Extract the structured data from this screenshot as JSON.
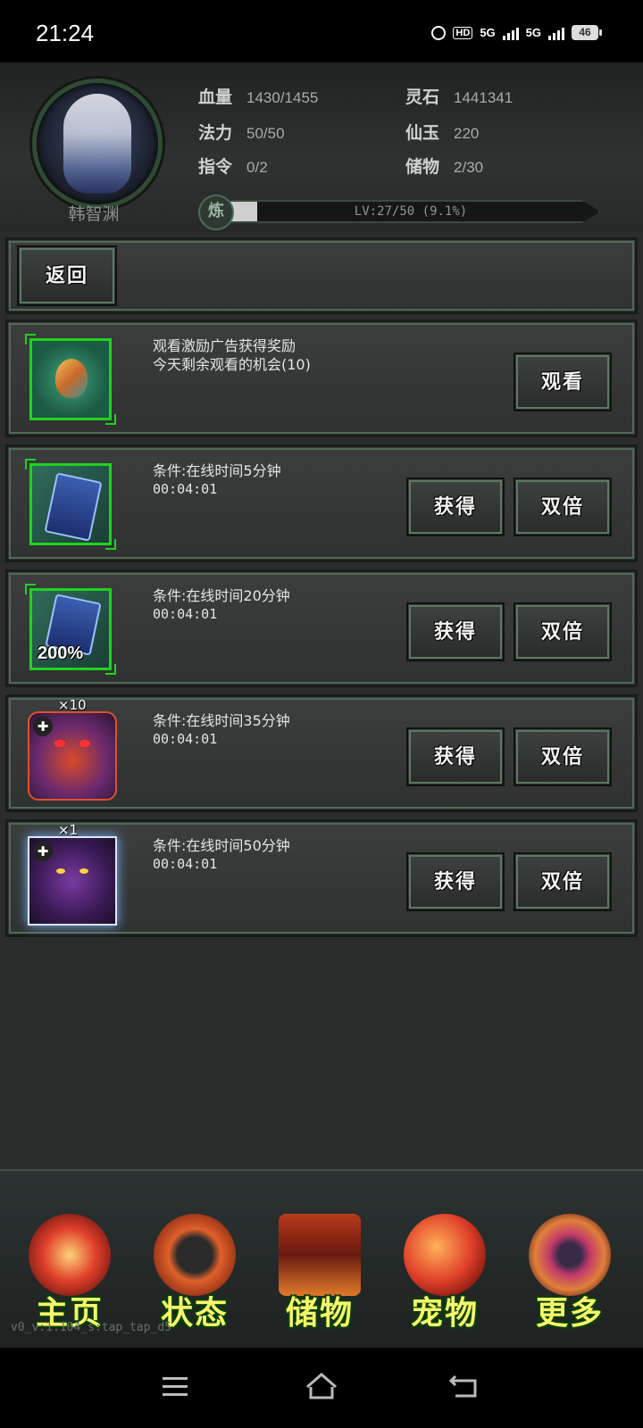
{
  "status_bar": {
    "time": "21:24",
    "network1": "5G",
    "network2": "5G",
    "hd_label": "HD",
    "battery": "46"
  },
  "header": {
    "character_name": "韩智渊",
    "stats": [
      {
        "label": "血量",
        "value": "1430/1455"
      },
      {
        "label": "灵石",
        "value": "1441341"
      },
      {
        "label": "法力",
        "value": "50/50"
      },
      {
        "label": "仙玉",
        "value": "220"
      },
      {
        "label": "指令",
        "value": "0/2"
      },
      {
        "label": "储物",
        "value": "2/30"
      }
    ],
    "exp_badge": "炼",
    "level_text": "LV:27/50 (9.1%)",
    "exp_progress": 0.091
  },
  "back_button": "返回",
  "rewards": [
    {
      "title": "观看激励广告获得奖励",
      "subtitle": "今天剩余观看的机会(10)",
      "icon": "spirit-stone-icon",
      "buttons": [
        "观看"
      ]
    },
    {
      "title": "条件:在线时间5分钟",
      "subtitle": "00:04:01",
      "icon": "blue-card-icon",
      "buttons": [
        "获得",
        "双倍"
      ]
    },
    {
      "title": "条件:在线时间20分钟",
      "subtitle": "00:04:01",
      "icon": "double-card-icon",
      "badge": "200%",
      "buttons": [
        "获得",
        "双倍"
      ]
    },
    {
      "title": "条件:在线时间35分钟",
      "subtitle": "00:04:01",
      "icon": "demon-portrait-icon",
      "quantity": "×10",
      "buttons": [
        "获得",
        "双倍"
      ]
    },
    {
      "title": "条件:在线时间50分钟",
      "subtitle": "00:04:01",
      "icon": "purple-demon-icon",
      "quantity": "×1",
      "buttons": [
        "获得",
        "双倍"
      ]
    }
  ],
  "bottom_nav": [
    {
      "label": "主页",
      "icon": "home-emblem-icon"
    },
    {
      "label": "状态",
      "icon": "status-emblem-icon"
    },
    {
      "label": "储物",
      "icon": "storage-emblem-icon"
    },
    {
      "label": "宠物",
      "icon": "pet-phoenix-icon"
    },
    {
      "label": "更多",
      "icon": "more-emblem-icon"
    }
  ],
  "version": "v0_v:1.104_s:tap_tap_d5"
}
